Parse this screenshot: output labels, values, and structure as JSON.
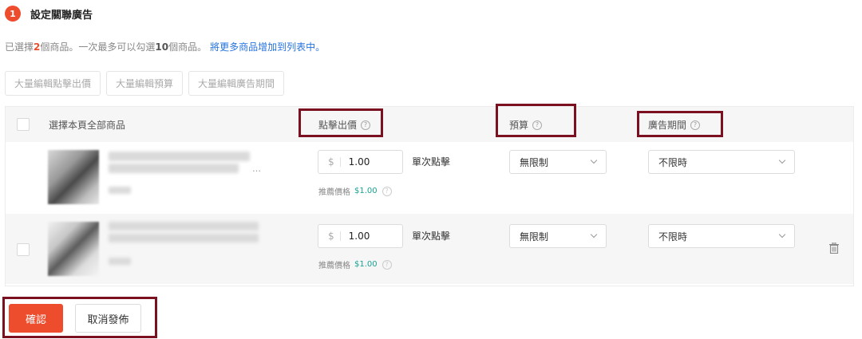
{
  "step": {
    "number": "1",
    "title": "設定關聯廣告"
  },
  "info": {
    "prefix": "已選擇",
    "count": "2",
    "mid": "個商品。一次最多可以勾選",
    "max": "10",
    "suffix": "個商品。",
    "link": "將更多商品增加到列表中。"
  },
  "bulk": {
    "bid": "大量編輯點擊出價",
    "budget": "大量編輯預算",
    "period": "大量編輯廣告期間"
  },
  "table": {
    "headers": {
      "select_all": "選擇本頁全部商品",
      "bid": "點擊出價",
      "budget": "預算",
      "period": "廣告期間"
    },
    "rows": [
      {
        "name_visible": "…",
        "price_currency": "$",
        "price": "1.00",
        "unit": "單次點擊",
        "suggest_label": "推薦價格",
        "suggest_value": "$1.00",
        "budget": "無限制",
        "period": "不限時"
      },
      {
        "price_currency": "$",
        "price": "1.00",
        "unit": "單次點擊",
        "suggest_label": "推薦價格",
        "suggest_value": "$1.00",
        "budget": "無限制",
        "period": "不限時"
      }
    ]
  },
  "actions": {
    "confirm": "確認",
    "cancel": "取消發佈"
  },
  "colors": {
    "accent": "#ee4d2d",
    "link": "#2673dd",
    "suggest": "#1aa192",
    "highlight": "#7a1020"
  }
}
